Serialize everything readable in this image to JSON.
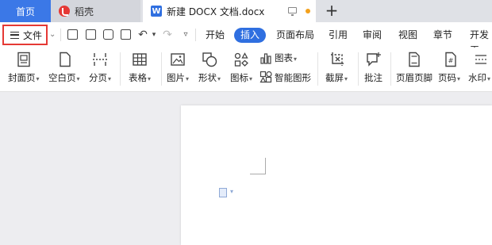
{
  "tabs": {
    "home": "首页",
    "shell": "稻壳",
    "document": "新建 DOCX 文档.docx"
  },
  "file_menu": {
    "label": "文件"
  },
  "menu_tabs": [
    "开始",
    "插入",
    "页面布局",
    "引用",
    "审阅",
    "视图",
    "章节",
    "开发工"
  ],
  "active_menu_tab": "插入",
  "ribbon": {
    "cover_page": "封面页",
    "blank_page": "空白页",
    "page_break": "分页",
    "table": "表格",
    "picture": "图片",
    "shape": "形状",
    "icon": "图标",
    "chart": "图表",
    "smart_art": "智能图形",
    "screenshot": "截屏",
    "comment": "批注",
    "header_footer": "页眉页脚",
    "page_number": "页码",
    "watermark": "水印"
  },
  "colors": {
    "accent": "#2f6fe0",
    "highlight_box": "#e53935",
    "unsaved_dot": "#f3a11c"
  }
}
